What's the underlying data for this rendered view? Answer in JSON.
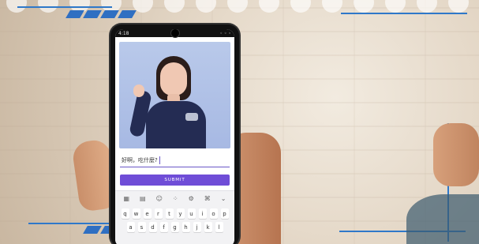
{
  "status": {
    "time": "4:18",
    "right": "◦ ◦ ◦"
  },
  "app": {
    "input_text": "好啊，吃什麼?",
    "submit_label": "SUBMIT"
  },
  "keyboard": {
    "toolbar": [
      "▦",
      "▤",
      "☺",
      "⁘",
      "⚙",
      "⌘",
      "⌄"
    ],
    "row1": [
      "q",
      "w",
      "e",
      "r",
      "t",
      "y",
      "u",
      "i",
      "o",
      "p"
    ],
    "row2": [
      "a",
      "s",
      "d",
      "f",
      "g",
      "h",
      "j",
      "k",
      "l"
    ]
  },
  "colors": {
    "accent": "#6f4dd7",
    "frame": "#2f78c9"
  }
}
